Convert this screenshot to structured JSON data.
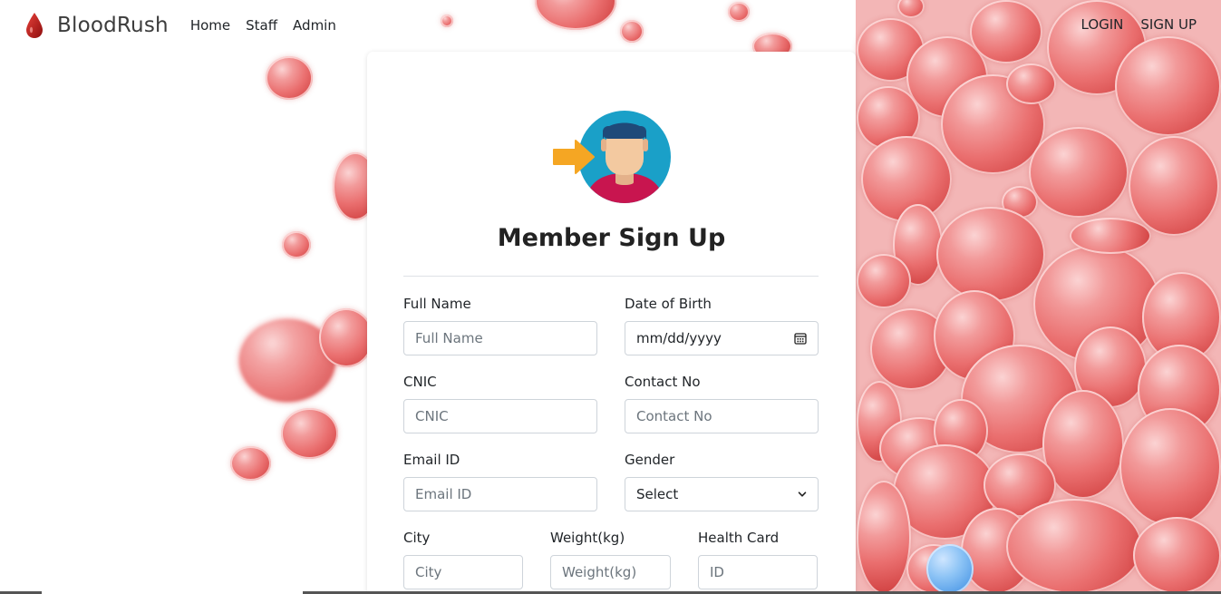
{
  "brand": {
    "name": "BloodRush",
    "icon": "blood-drop-icon"
  },
  "nav": {
    "left": [
      "Home",
      "Staff",
      "Admin"
    ],
    "right": [
      "LOGIN",
      "SIGN UP"
    ]
  },
  "form": {
    "title": "Member Sign Up",
    "avatar_icon": "user-avatar-arrow-icon",
    "fields": {
      "full_name": {
        "label": "Full Name",
        "placeholder": "Full Name"
      },
      "dob": {
        "label": "Date of Birth",
        "placeholder": "mm/dd/yyyy"
      },
      "cnic": {
        "label": "CNIC",
        "placeholder": "CNIC"
      },
      "contact": {
        "label": "Contact No",
        "placeholder": "Contact No"
      },
      "email": {
        "label": "Email ID",
        "placeholder": "Email ID"
      },
      "gender": {
        "label": "Gender",
        "selected": "Select"
      },
      "city": {
        "label": "City",
        "placeholder": "City"
      },
      "weight": {
        "label": "Weight(kg)",
        "placeholder": "Weight(kg)"
      },
      "health_card": {
        "label": "Health Card",
        "placeholder": "ID"
      }
    }
  },
  "colors": {
    "accent_red": "#c0392b",
    "cell_red": "#ea6f6f",
    "avatar_bg": "#1aa0c8",
    "arrow": "#f5a623"
  }
}
